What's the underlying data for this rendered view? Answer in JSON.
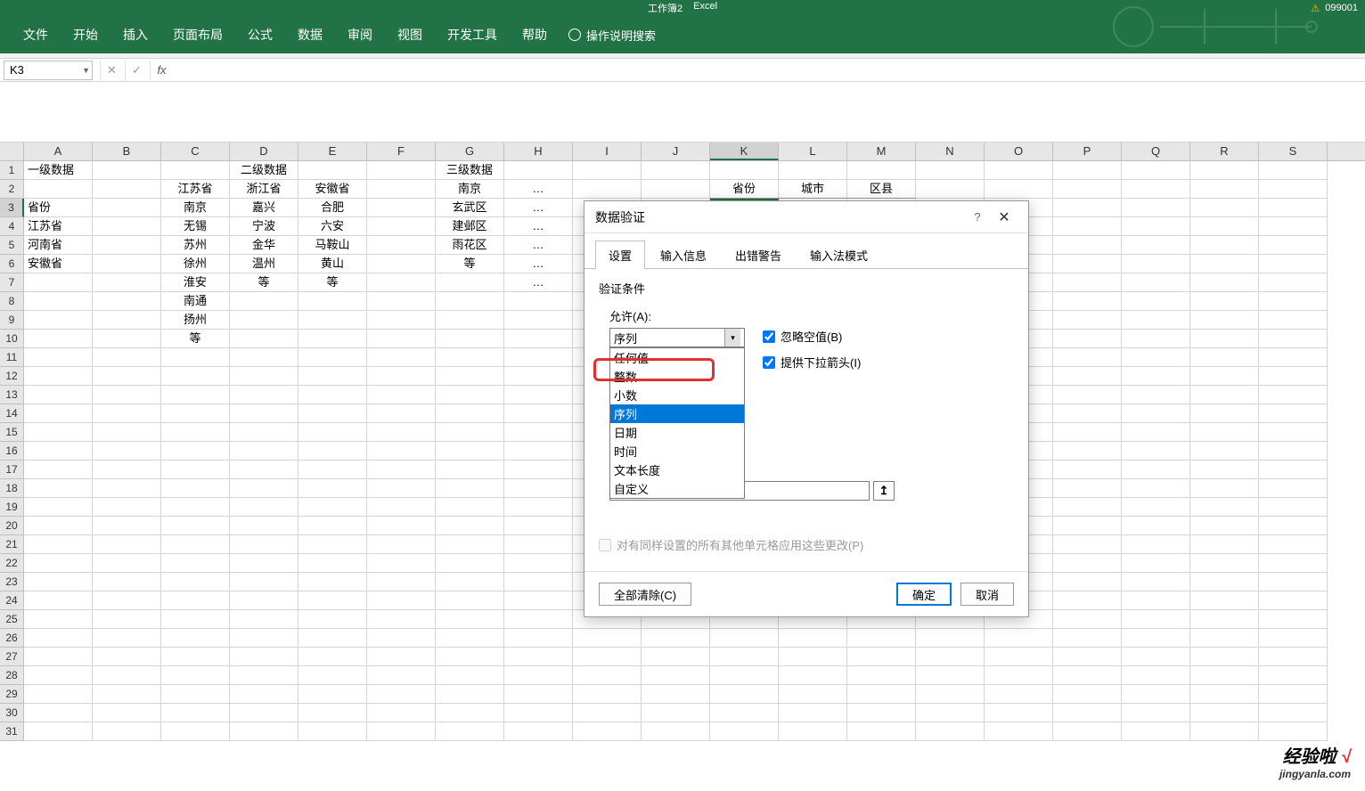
{
  "title": {
    "doc": "工作簿2",
    "app": "Excel",
    "warn_num": "099001"
  },
  "ribbon": {
    "tabs": [
      "文件",
      "开始",
      "插入",
      "页面布局",
      "公式",
      "数据",
      "审阅",
      "视图",
      "开发工具",
      "帮助"
    ],
    "tell_me": "操作说明搜索"
  },
  "namebox": {
    "value": "K3"
  },
  "fx": {
    "cancel": "✕",
    "enter": "✓",
    "fx": "fx"
  },
  "columns": [
    "A",
    "B",
    "C",
    "D",
    "E",
    "F",
    "G",
    "H",
    "I",
    "J",
    "K",
    "L",
    "M",
    "N",
    "O",
    "P",
    "Q",
    "R",
    "S"
  ],
  "active_col": "K",
  "active_row": "3",
  "sheet": {
    "r1": {
      "A": "一级数据",
      "D": "二级数据",
      "G": "三级数据"
    },
    "r2": {
      "C": "江苏省",
      "D": "浙江省",
      "E": "安徽省",
      "G": "南京",
      "H": "…",
      "K": "省份",
      "L": "城市",
      "M": "区县"
    },
    "r3": {
      "A": "省份",
      "C": "南京",
      "D": "嘉兴",
      "E": "合肥",
      "G": "玄武区",
      "H": "…"
    },
    "r4": {
      "A": "江苏省",
      "C": "无锡",
      "D": "宁波",
      "E": "六安",
      "G": "建邺区",
      "H": "…"
    },
    "r5": {
      "A": "河南省",
      "C": "苏州",
      "D": "金华",
      "E": "马鞍山",
      "G": "雨花区",
      "H": "…"
    },
    "r6": {
      "A": "安徽省",
      "C": "徐州",
      "D": "温州",
      "E": "黄山",
      "G": "等",
      "H": "…"
    },
    "r7": {
      "C": "淮安",
      "D": "等",
      "E": "等",
      "H": "…"
    },
    "r8": {
      "C": "南通"
    },
    "r9": {
      "C": "扬州"
    },
    "r10": {
      "C": "等"
    }
  },
  "dialog": {
    "title": "数据验证",
    "help": "?",
    "close": "✕",
    "tabs": [
      "设置",
      "输入信息",
      "出错警告",
      "输入法模式"
    ],
    "section": "验证条件",
    "allow_label": "允许(A):",
    "combo_value": "序列",
    "options": [
      "任何值",
      "整数",
      "小数",
      "序列",
      "日期",
      "时间",
      "文本长度",
      "自定义"
    ],
    "ignore_blank": "忽略空值(B)",
    "dropdown": "提供下拉箭头(I)",
    "src_btn": "↥",
    "apply_all": "对有同样设置的所有其他单元格应用这些更改(P)",
    "clear": "全部清除(C)",
    "ok": "确定",
    "cancel": "取消"
  },
  "watermark": {
    "line1a": "经验啦",
    "line1b": "√",
    "line2": "jingyanla.com"
  }
}
